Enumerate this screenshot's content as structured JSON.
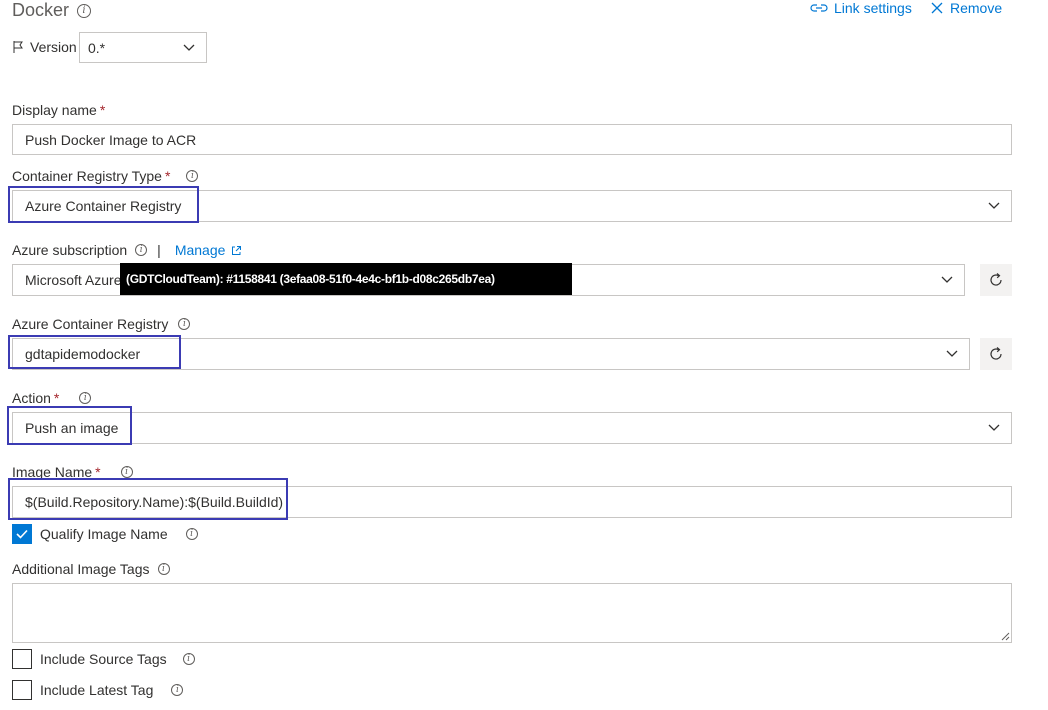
{
  "header": {
    "title": "Docker",
    "link_settings": "Link settings",
    "remove": "Remove"
  },
  "version": {
    "label": "Version",
    "value": "0.*"
  },
  "display_name": {
    "label": "Display name",
    "required": "*",
    "value": "Push Docker Image to ACR"
  },
  "registry_type": {
    "label": "Container Registry Type",
    "required": "*",
    "value": "Azure Container Registry"
  },
  "subscription": {
    "label": "Azure subscription",
    "separator": "|",
    "manage": "Manage",
    "value": "Microsoft Azure",
    "redacted": "(GDTCloudTeam): #1158841 (3efaa08-51f0-4e4c-bf1b-d08c265db7ea)"
  },
  "registry": {
    "label": "Azure Container Registry",
    "value": "gdtapidemodocker"
  },
  "action": {
    "label": "Action",
    "required": "*",
    "value": "Push an image"
  },
  "image_name": {
    "label": "Image Name",
    "required": "*",
    "value": "$(Build.Repository.Name):$(Build.BuildId)"
  },
  "qualify": {
    "label": "Qualify Image Name",
    "checked": true
  },
  "additional_tags": {
    "label": "Additional Image Tags",
    "value": ""
  },
  "include_source": {
    "label": "Include Source Tags",
    "checked": false
  },
  "include_latest": {
    "label": "Include Latest Tag",
    "checked": false
  },
  "colors": {
    "accent": "#0078d4",
    "highlight": "#3b3bb3",
    "required": "#a4262c"
  }
}
